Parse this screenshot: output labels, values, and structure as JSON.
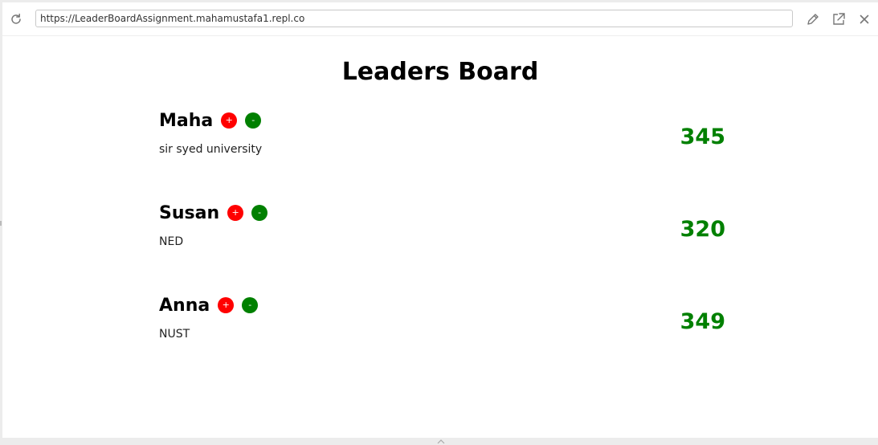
{
  "browser": {
    "url": "https://LeaderBoardAssignment.mahamustafa1.repl.co",
    "icons": [
      "reload-icon",
      "edit-icon",
      "external-link-icon",
      "close-icon"
    ]
  },
  "page": {
    "title": "Leaders Board"
  },
  "players": [
    {
      "name": "Maha",
      "org": "sir syed university",
      "score": "345",
      "plus_label": "+",
      "minus_label": "-"
    },
    {
      "name": "Susan",
      "org": "NED",
      "score": "320",
      "plus_label": "+",
      "minus_label": "-"
    },
    {
      "name": "Anna",
      "org": "NUST",
      "score": "349",
      "plus_label": "+",
      "minus_label": "-"
    }
  ],
  "colors": {
    "plus_button": "#ff0000",
    "minus_button": "#008000",
    "score": "#008000"
  }
}
